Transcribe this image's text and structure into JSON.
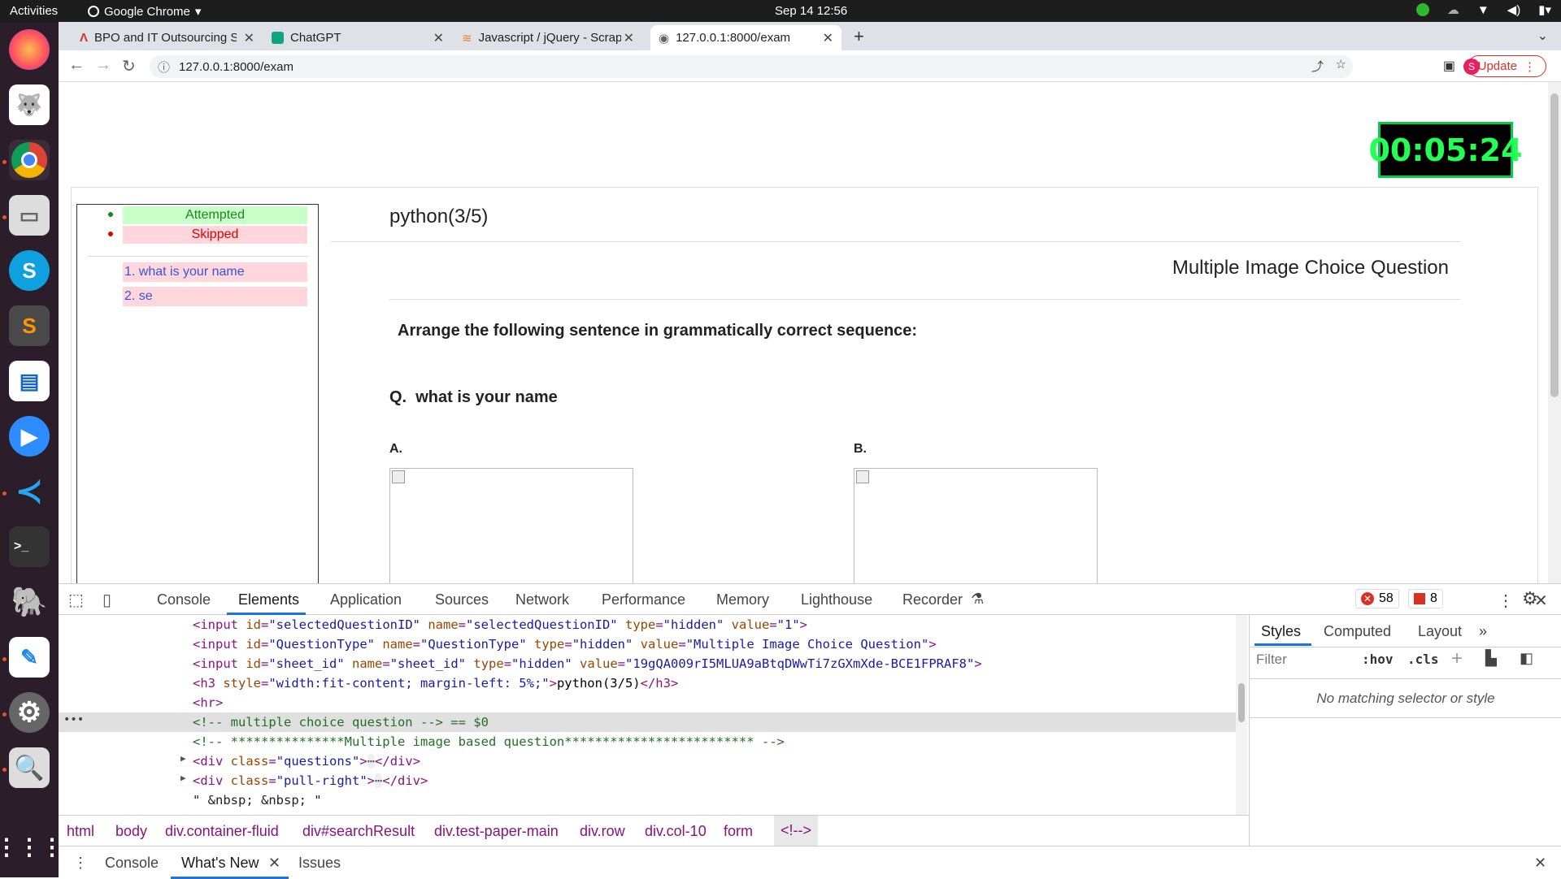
{
  "system": {
    "activities": "Activities",
    "app_name": "Google Chrome",
    "clock": "Sep 14  12:56"
  },
  "tabs": [
    {
      "title": "BPO and IT Outsourcing S"
    },
    {
      "title": "ChatGPT"
    },
    {
      "title": "Javascript / jQuery - Scrap"
    },
    {
      "title": "127.0.0.1:8000/exam"
    }
  ],
  "address": {
    "url": "127.0.0.1:8000/exam",
    "update_label": "Update",
    "profile_initial": "S"
  },
  "exam": {
    "timer": "00:05:24",
    "legend": {
      "attempted": "Attempted",
      "skipped": "Skipped"
    },
    "questions": [
      "1. what is your name",
      "2. se"
    ],
    "heading": "python(3/5)",
    "type": "Multiple Image Choice Question",
    "instruction": "Arrange the following sentence in grammatically correct sequence:",
    "question_prefix": "Q.",
    "question": "what is your name",
    "options": [
      "A.",
      "B."
    ]
  },
  "devtools": {
    "tabs": [
      "Console",
      "Elements",
      "Application",
      "Sources",
      "Network",
      "Performance",
      "Memory",
      "Lighthouse",
      "Recorder"
    ],
    "errors": "58",
    "warnings": "8",
    "style_tabs": [
      "Styles",
      "Computed",
      "Layout"
    ],
    "filter_placeholder": "Filter",
    "hov": ":hov",
    "cls": ".cls",
    "no_match": "No matching selector or style",
    "breadcrumbs": [
      "html",
      "body",
      "div.container-fluid",
      "div#searchResult",
      "div.test-paper-main",
      "div.row",
      "div.col-10",
      "form",
      "<!-->"
    ],
    "drawer": [
      "Console",
      "What's New",
      "Issues"
    ],
    "code": {
      "l1": "<input id=\"selectedQuestionID\" name=\"selectedQuestionID\" type=\"hidden\" value=\"1\">",
      "l2": "<input id=\"QuestionType\" name=\"QuestionType\" type=\"hidden\" value=\"Multiple Image Choice Question\">",
      "l3": "<input id=\"sheet_id\" name=\"sheet_id\" type=\"hidden\" value=\"19gQA009rI5MLUA9aBtqDWwTi7zGXmXde-BCE1FPRAF8\">",
      "l4": "<h3 style=\"width:fit-content; margin-left: 5%;\">python(3/5)</h3>",
      "l5": "<hr>",
      "l6": "<!-- multiple choice question --> == $0",
      "l7": "<!-- ***************Multiple image based question************************* -->",
      "l8": "<div class=\"questions\">⋯</div>",
      "l9": "<div class=\"pull-right\">⋯</div>",
      "l10": "\" &nbsp; &nbsp; \""
    }
  },
  "colors": {
    "attempted_bg": "#c9ffc9",
    "attempted_text": "#1a8a1a",
    "skipped_bg": "#ffd6dc",
    "skipped_text": "#e00000",
    "link": "#3355dd",
    "timer_green": "#22ff55"
  }
}
